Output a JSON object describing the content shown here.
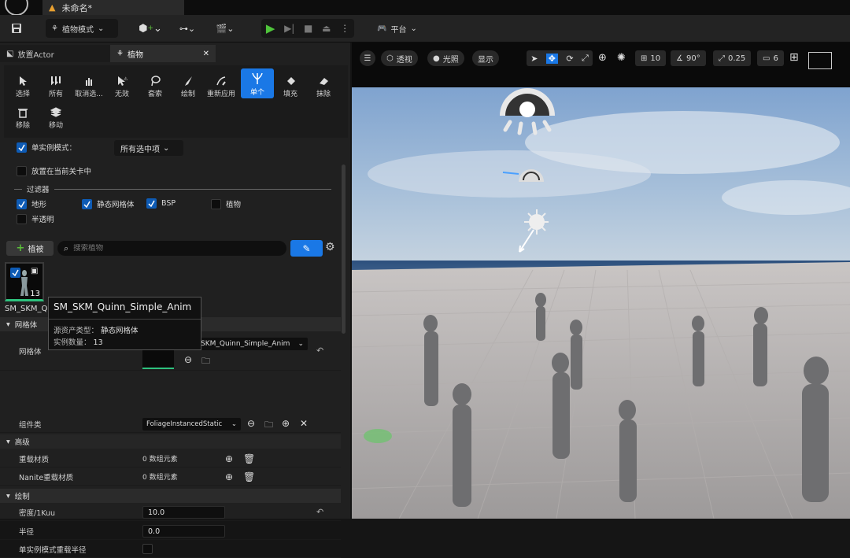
{
  "window": {
    "tab_title": "未命名*"
  },
  "toolbar": {
    "mode_label": "植物模式",
    "platform_label": "平台"
  },
  "panel": {
    "tabs": [
      {
        "label": "放置Actor"
      },
      {
        "label": "植物"
      }
    ],
    "modes": [
      {
        "label": "选择"
      },
      {
        "label": "所有"
      },
      {
        "label": "取消选..."
      },
      {
        "label": "无效"
      },
      {
        "label": "套索"
      },
      {
        "label": "绘制"
      },
      {
        "label": "重新应用"
      },
      {
        "label": "单个"
      },
      {
        "label": "填充"
      },
      {
        "label": "抹除"
      },
      {
        "label": "移除"
      },
      {
        "label": "移动"
      }
    ],
    "single_instance_label": "单实例模式：",
    "single_instance_value": "所有选中项",
    "place_in_level_label": "放置在当前关卡中",
    "filter_title": "过滤器",
    "filters": [
      {
        "label": "地形",
        "checked": true
      },
      {
        "label": "静态网格体",
        "checked": true
      },
      {
        "label": "BSP",
        "checked": true
      },
      {
        "label": "植物",
        "checked": false
      },
      {
        "label": "半透明",
        "checked": false
      }
    ],
    "add_foliage_label": "植被",
    "search_placeholder": "搜索植物",
    "asset": {
      "count": "13",
      "name_label": "SM_SKM_Q"
    }
  },
  "tooltip": {
    "title": "SM_SKM_Quinn_Simple_Anim",
    "type_label": "源资产类型：",
    "type_value": "静态网格体",
    "count_label": "实例数量：",
    "count_value": "13"
  },
  "details": {
    "mesh_section": "网格体",
    "mesh_label": "网格体",
    "mesh_value": "SKM_Quinn_Simple_Anim",
    "component_label": "组件类",
    "component_value": "FoliageInstancedStatic",
    "advanced_section": "高级",
    "override_material_label": "重载材质",
    "override_material_value": "0 数组元素",
    "nanite_override_label": "Nanite重载材质",
    "nanite_override_value": "0 数组元素",
    "paint_section": "绘制",
    "density_label": "密度/1Kuu",
    "density_value": "10.0",
    "radius_label": "半径",
    "radius_value": "0.0",
    "single_radius_label": "单实例模式重载半径"
  },
  "viewport": {
    "perspective_label": "透视",
    "lit_label": "光照",
    "show_label": "显示",
    "grid_value": "10",
    "angle_value": "90°",
    "scale_value": "0.25",
    "camera_speed": "6"
  }
}
